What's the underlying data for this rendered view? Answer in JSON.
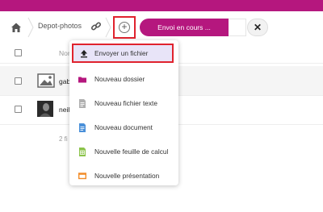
{
  "breadcrumb": {
    "folder": "Depot-photos"
  },
  "upload": {
    "status": "Envoi en cours ...",
    "cancel": "✕"
  },
  "table": {
    "header_name": "Nom"
  },
  "files": [
    {
      "name": "gab"
    },
    {
      "name": "neil"
    }
  ],
  "summary": "2 fi",
  "new_menu": {
    "items": [
      {
        "label": "Envoyer un fichier",
        "icon": "upload-icon"
      },
      {
        "label": "Nouveau dossier",
        "icon": "folder-icon"
      },
      {
        "label": "Nouveau fichier texte",
        "icon": "text-file-icon"
      },
      {
        "label": "Nouveau document",
        "icon": "document-icon"
      },
      {
        "label": "Nouvelle feuille de calcul",
        "icon": "spreadsheet-icon"
      },
      {
        "label": "Nouvelle présentation",
        "icon": "presentation-icon"
      }
    ]
  },
  "colors": {
    "brand": "#b5177e",
    "highlight_border": "#e0232e",
    "folder": "#b5177e",
    "text_file": "#b0b0b0",
    "document": "#4a90d9",
    "spreadsheet": "#8bc34a",
    "presentation": "#f28c28"
  }
}
